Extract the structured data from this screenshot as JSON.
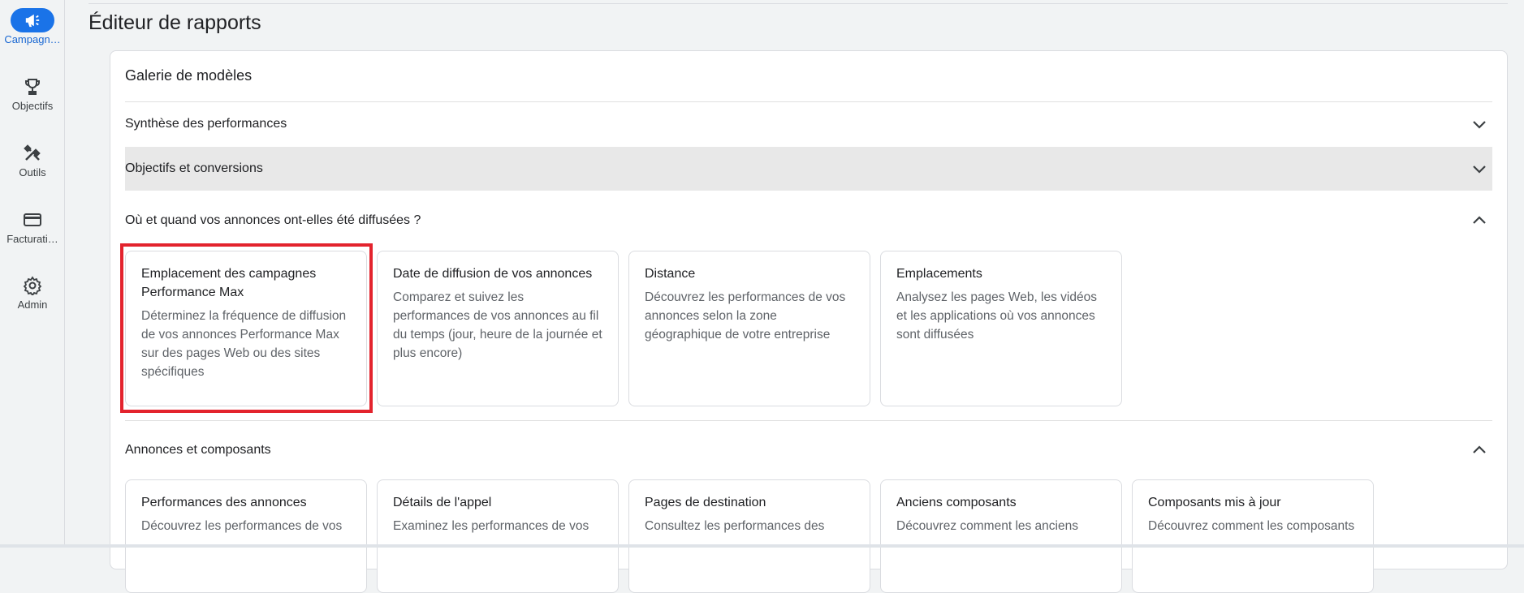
{
  "sidebar": {
    "items": [
      {
        "label": "Campagn…",
        "icon": "megaphone-icon",
        "active": true
      },
      {
        "label": "Objectifs",
        "icon": "trophy-icon"
      },
      {
        "label": "Outils",
        "icon": "tools-icon"
      },
      {
        "label": "Facturati…",
        "icon": "credit-card-icon"
      },
      {
        "label": "Admin",
        "icon": "gear-icon"
      }
    ]
  },
  "page": {
    "title": "Éditeur de rapports"
  },
  "gallery": {
    "title": "Galerie de modèles",
    "sections": [
      {
        "title": "Synthèse des performances",
        "expanded": false
      },
      {
        "title": "Objectifs et conversions",
        "expanded": false,
        "highlighted": true
      },
      {
        "title": "Où et quand vos annonces ont-elles été diffusées ?",
        "expanded": true,
        "cards": [
          {
            "title": "Emplacement des campagnes Performance Max",
            "desc": "Déterminez la fréquence de diffusion de vos annonces Performance Max sur des pages Web ou des sites spécifiques",
            "selected": true
          },
          {
            "title": "Date de diffusion de vos annonces",
            "desc": "Comparez et suivez les performances de vos annonces au fil du temps (jour, heure de la journée et plus encore)"
          },
          {
            "title": "Distance",
            "desc": "Découvrez les performances de vos annonces selon la zone géographique de votre entreprise"
          },
          {
            "title": "Emplacements",
            "desc": "Analysez les pages Web, les vidéos et les applications où vos annonces sont diffusées"
          }
        ]
      },
      {
        "title": "Annonces et composants",
        "expanded": true,
        "cards": [
          {
            "title": "Performances des annonces",
            "desc": "Découvrez les performances de vos"
          },
          {
            "title": "Détails de l'appel",
            "desc": "Examinez les performances de vos"
          },
          {
            "title": "Pages de destination",
            "desc": "Consultez les performances des"
          },
          {
            "title": "Anciens composants",
            "desc": "Découvrez comment les anciens"
          },
          {
            "title": "Composants mis à jour",
            "desc": "Découvrez comment les composants"
          }
        ]
      }
    ]
  },
  "colors": {
    "accent": "#1a73e8",
    "highlight": "#e3232d"
  }
}
